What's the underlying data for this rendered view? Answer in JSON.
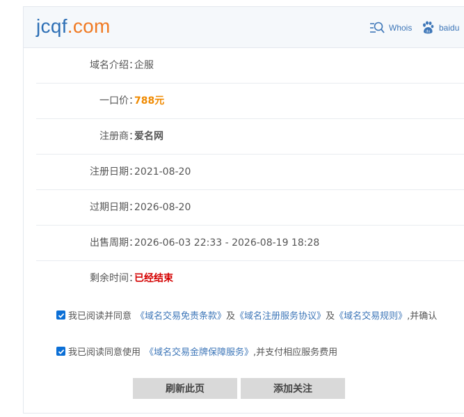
{
  "header": {
    "logo_name": "jcqf",
    "logo_tld": ".com",
    "whois_label": "Whois",
    "baidu_label": "baidu"
  },
  "rows": [
    {
      "label": "域名介绍：",
      "value": "企服"
    },
    {
      "label": "一口价：",
      "value": "788元"
    },
    {
      "label": "注册商：",
      "value": "爱名网"
    },
    {
      "label": "注册日期：",
      "value": "2021-08-20"
    },
    {
      "label": "过期日期：",
      "value": "2026-08-20"
    },
    {
      "label": "出售周期：",
      "value": "2026-06-03 22:33 - 2026-08-19 18:28"
    },
    {
      "label": "剩余时间：",
      "value": "已经结束"
    }
  ],
  "agreements": {
    "first": {
      "checked": true,
      "prefix": "我已阅读并同意",
      "link1": "《域名交易免责条款》",
      "sep1": "及",
      "link2": "《域名注册服务协议》",
      "sep2": "及",
      "link3": "《域名交易规则》",
      "suffix": ",并确认"
    },
    "second": {
      "checked": true,
      "prefix": "我已阅读同意使用",
      "link": "《域名交易金牌保障服务》",
      "suffix": ",并支付相应服务费用"
    }
  },
  "buttons": {
    "refresh_label": "刷新此页",
    "follow_label": "添加关注"
  },
  "colors": {
    "brand_blue": "#2d6fb5",
    "brand_orange": "#f07a23",
    "price": "#f08a00",
    "ended": "#d40000",
    "link": "#3d76b8",
    "checkbox": "#0b6fd6"
  },
  "icons": {
    "whois": "whois-search-icon",
    "baidu": "baidu-paw-icon",
    "checkbox": "checkmark-icon"
  }
}
